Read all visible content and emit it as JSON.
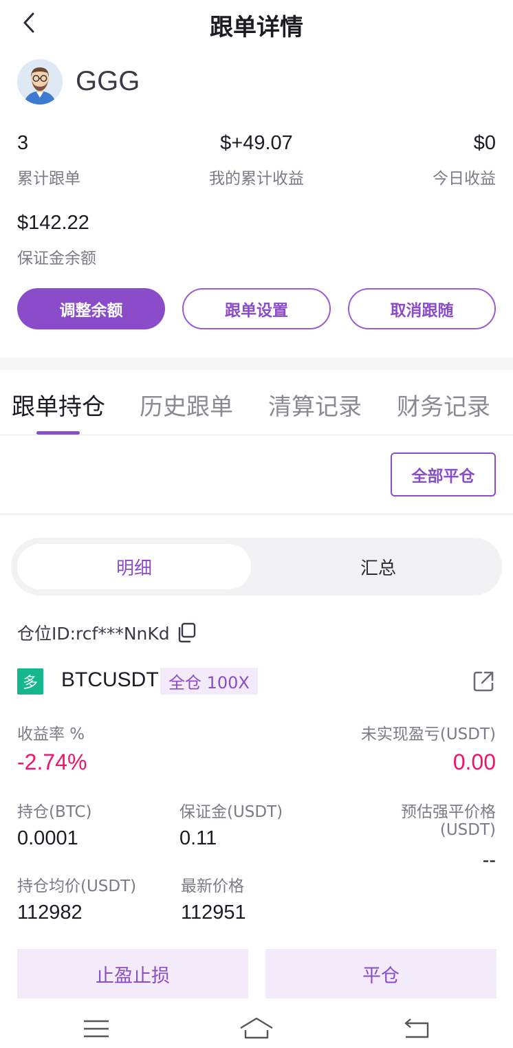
{
  "header": {
    "title": "跟单详情",
    "back_icon": "chevron-left-icon"
  },
  "profile": {
    "name": "GGG",
    "avatar_icon": "avatar-icon"
  },
  "stats": {
    "count_value": "3",
    "count_label": "累计跟单",
    "profit_value": "$+49.07",
    "profit_label": "我的累计收益",
    "today_value": "$0",
    "today_label": "今日收益",
    "margin_value": "$142.22",
    "margin_label": "保证金余额"
  },
  "actions": {
    "adjust": "调整余额",
    "settings": "跟单设置",
    "cancel": "取消跟随"
  },
  "tabs": [
    {
      "label": "跟单持仓",
      "active": true
    },
    {
      "label": "历史跟单",
      "active": false
    },
    {
      "label": "清算记录",
      "active": false
    },
    {
      "label": "财务记录",
      "active": false
    }
  ],
  "close_all": "全部平仓",
  "segment": {
    "detail": "明细",
    "summary": "汇总"
  },
  "position": {
    "id": "仓位ID:rcf***NnKd",
    "side": "多",
    "symbol": "BTCUSDT",
    "mode": "全仓 100X",
    "roe_label": "收益率 %",
    "roe_value": "-2.74%",
    "upnl_label": "未实现盈亏(USDT)",
    "upnl_value": "0.00",
    "size_label": "持仓(BTC)",
    "size_value": "0.0001",
    "margin_label": "保证金(USDT)",
    "margin_value": "0.11",
    "liq_label_1": "预估强平价格",
    "liq_label_2": "(USDT)",
    "liq_value": "--",
    "entry_label": "持仓均价(USDT)",
    "entry_value": "112982",
    "mark_label": "最新价格",
    "mark_value": "112951"
  },
  "bottom_buttons": {
    "tpsl": "止盈止损",
    "close": "平仓"
  },
  "colors": {
    "accent": "#8a4cc8",
    "negative": "#f0146a",
    "long": "#16b78c"
  }
}
